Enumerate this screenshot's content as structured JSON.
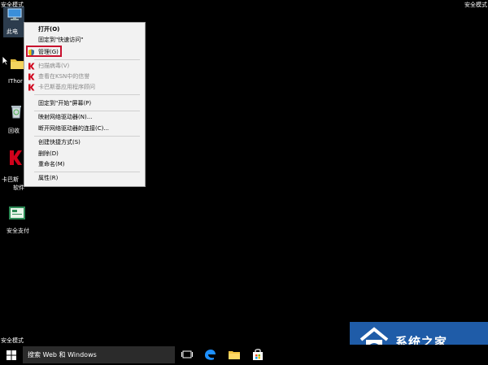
{
  "screen": {
    "safe_mode_label": "安全模式"
  },
  "desktop": {
    "icons": [
      {
        "label": "此电",
        "icon": "computer-icon"
      },
      {
        "label": "IThor",
        "icon": "folder-icon"
      },
      {
        "label": "回收",
        "icon": "recycle-bin-icon"
      },
      {
        "label": "卡巴斯",
        "label2": "软件",
        "icon": "kaspersky-icon"
      },
      {
        "label": "安全支付",
        "icon": "safe-payment-icon"
      }
    ]
  },
  "context_menu": {
    "items": [
      {
        "label": "打开(O)",
        "bold": true
      },
      {
        "label": "固定到\"快速访问\""
      },
      {
        "label": "管理(G)",
        "highlighted": true,
        "icon": "shield-icon"
      },
      {
        "label": "扫描病毒(V)",
        "disabled": true,
        "icon": "kaspersky-icon"
      },
      {
        "label": "查看在KSN中的信誉",
        "disabled": true,
        "icon": "kaspersky-icon"
      },
      {
        "label": "卡巴斯基应用程序顾问",
        "disabled": true,
        "icon": "kaspersky-icon"
      },
      {
        "label": "固定到\"开始\"屏幕(P)"
      },
      {
        "label": "映射网络驱动器(N)..."
      },
      {
        "label": "断开网络驱动器的连接(C)..."
      },
      {
        "label": "创建快捷方式(S)"
      },
      {
        "label": "删除(D)"
      },
      {
        "label": "重命名(M)"
      },
      {
        "label": "属性(R)"
      }
    ],
    "highlight_color": "#c8102e"
  },
  "taskbar": {
    "search_placeholder": "搜索 Web 和 Windows",
    "icons": [
      "task-view-icon",
      "edge-icon",
      "file-explorer-icon",
      "store-icon"
    ]
  },
  "watermark": {
    "text": "系统之家",
    "color": "#1f5ca8"
  }
}
